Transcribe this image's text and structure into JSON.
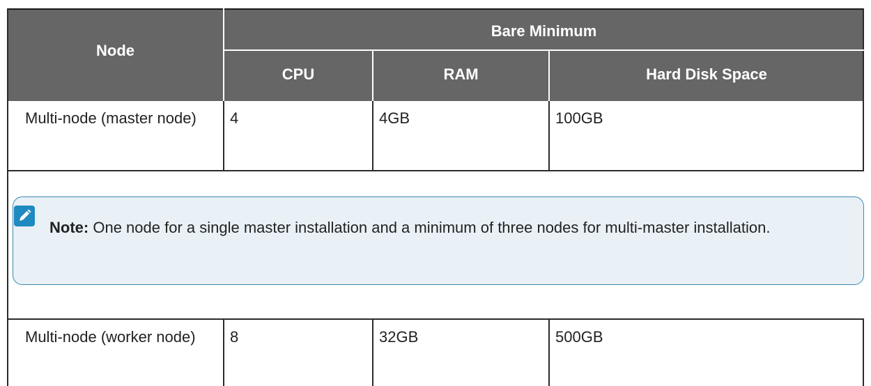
{
  "table": {
    "headers": {
      "node": "Node",
      "group": "Bare Minimum",
      "cpu": "CPU",
      "ram": "RAM",
      "disk": "Hard Disk Space"
    },
    "rows": [
      {
        "node": "Multi-node (master node)",
        "cpu": "4",
        "ram": "4GB",
        "disk": "100GB"
      },
      {
        "node": "Multi-node (worker node)",
        "cpu": "8",
        "ram": "32GB",
        "disk": "500GB"
      }
    ]
  },
  "note": {
    "label": "Note:",
    "text": "One node for a single master installation and a minimum of three nodes for multi-master installation.",
    "icon": "pencil-icon"
  },
  "colors": {
    "header_bg": "#666666",
    "note_bg": "#e9f1f7",
    "note_border": "#3b88b0",
    "icon_bg": "#1f8ac0"
  }
}
